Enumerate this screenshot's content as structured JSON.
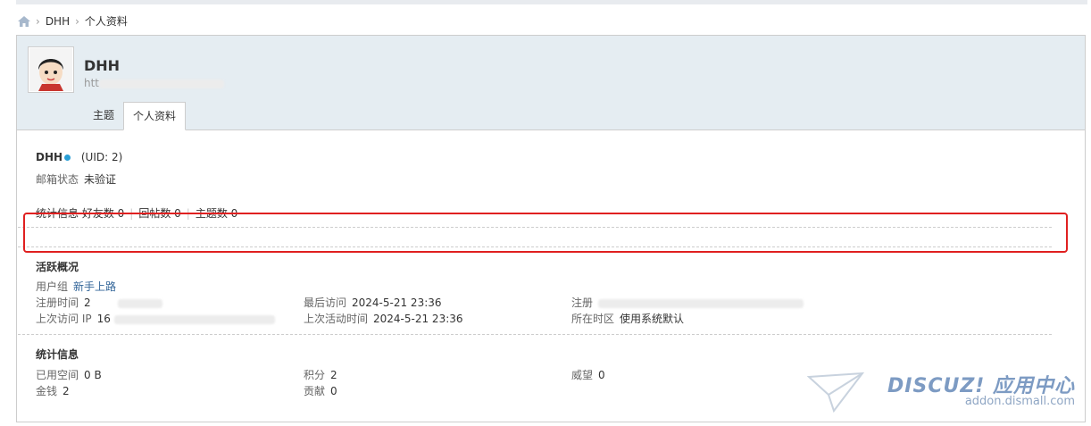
{
  "breadcrumb": {
    "items": [
      "DHH",
      "个人资料"
    ]
  },
  "profile": {
    "name": "DHH",
    "url_prefix": "htt"
  },
  "tabs": [
    {
      "label": "主题",
      "active": false
    },
    {
      "label": "个人资料",
      "active": true
    }
  ],
  "info": {
    "name": "DHH",
    "uid": "(UID: 2)",
    "email_label": "邮箱状态",
    "email_value": "未验证",
    "stats_label": "统计信息",
    "friends": "好友数 0",
    "replies": "回帖数 0",
    "threads": "主题数 0"
  },
  "activity": {
    "title": "活跃概况",
    "usergroup_label": "用户组",
    "usergroup_value": "新手上路",
    "reg_label": "注册时间",
    "reg_value": "2",
    "last_visit_label": "最后访问",
    "last_visit_value": "2024-5-21 23:36",
    "reg_ip_label": "注册",
    "last_ip_label": "上次访问 IP",
    "last_ip_value": "16",
    "last_active_label": "上次活动时间",
    "last_active_value": "2024-5-21 23:36",
    "tz_label": "所在时区",
    "tz_value": "使用系统默认"
  },
  "stats": {
    "title": "统计信息",
    "space_label": "已用空间",
    "space_value": "0 B",
    "credits_label": "积分",
    "credits_value": "2",
    "prestige_label": "威望",
    "prestige_value": "0",
    "money_label": "金钱",
    "money_value": "2",
    "contrib_label": "贡献",
    "contrib_value": "0"
  },
  "watermark": {
    "brand": "DISCUZ! 应用中心",
    "domain": "addon.dismall.com"
  },
  "colors": {
    "header_bg": "#e5edf2",
    "link": "#336699",
    "highlight_border": "#e02020",
    "online_dot": "#2a9fd6"
  }
}
